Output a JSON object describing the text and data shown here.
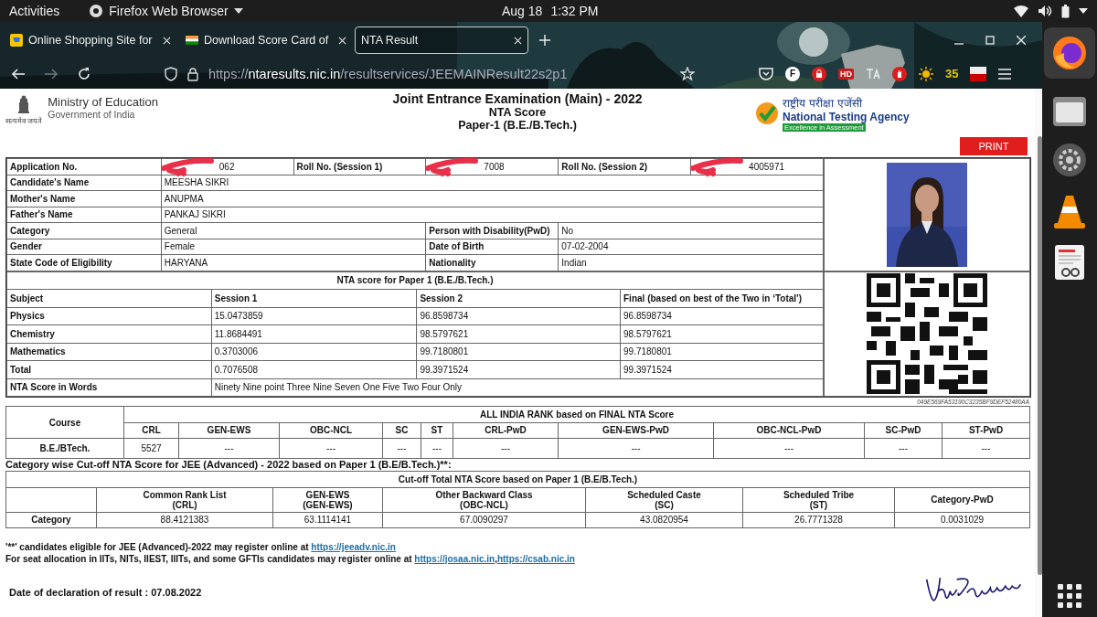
{
  "top_bar": {
    "activities": "Activities",
    "app_menu": "Firefox Web Browser",
    "date": "Aug 18",
    "time": "1:32 PM"
  },
  "tabs": [
    {
      "title": "Online Shopping Site for",
      "kind": "shop",
      "selected": false
    },
    {
      "title": "Download Score Card of",
      "kind": "flag",
      "selected": false
    },
    {
      "title": "NTA Result",
      "kind": "plain",
      "selected": true
    }
  ],
  "nav": {
    "forward_disabled": true,
    "url_scheme": "https://",
    "url_host": "ntaresults.nic.in",
    "url_path": "/resultservices/JEEMAINResult22s2p1",
    "badge": "35",
    "letter_icon": "F",
    "hd_icon": "HD"
  },
  "header": {
    "ministry": "Ministry of Education",
    "government": "Government of India",
    "motto": "सत्यमेव जयते",
    "title": "Joint Entrance Examination (Main) - 2022",
    "subtitle": "NTA Score",
    "paper": "Paper-1 (B.E./B.Tech.)",
    "agency_hindi": "राष्ट्रीय परीक्षा एजेंसी",
    "agency": "National Testing Agency",
    "agency_tag": "Excellence in Assessment",
    "print": "PRINT"
  },
  "candidate": [
    {
      "kind": "triple",
      "cells": [
        {
          "label": "Application No.",
          "value": "062"
        },
        {
          "label": "Roll No. (Session 1)",
          "value": "7008"
        },
        {
          "label": "Roll No. (Session 2)",
          "value": "4005971"
        }
      ]
    },
    {
      "kind": "full",
      "cells": [
        {
          "label": "Candidate's Name",
          "value": "MEESHA SIKRI"
        }
      ]
    },
    {
      "kind": "full",
      "cells": [
        {
          "label": "Mother's Name",
          "value": "ANUPMA"
        }
      ]
    },
    {
      "kind": "full",
      "cells": [
        {
          "label": "Father's Name",
          "value": "PANKAJ SIKRI"
        }
      ]
    },
    {
      "kind": "pair",
      "cells": [
        {
          "label": "Category",
          "value": "General"
        },
        {
          "label": "Person with Disability(PwD)",
          "value": "No"
        }
      ]
    },
    {
      "kind": "pair",
      "cells": [
        {
          "label": "Gender",
          "value": "Female"
        },
        {
          "label": "Date of Birth",
          "value": "07-02-2004"
        }
      ]
    },
    {
      "kind": "pair",
      "cells": [
        {
          "label": "State Code of Eligibility",
          "value": "HARYANA"
        },
        {
          "label": "Nationality",
          "value": "Indian"
        }
      ]
    }
  ],
  "score": {
    "title": "NTA score for Paper 1 (B.E./B.Tech.)",
    "columns": [
      "Subject",
      "Session 1",
      "Session 2",
      "Final (based on best of the Two in ‘Total’)"
    ],
    "rows": [
      [
        "Physics",
        "15.0473859",
        "96.8598734",
        "96.8598734"
      ],
      [
        "Chemistry",
        "11.8684491",
        "98.5797621",
        "98.5797621"
      ],
      [
        "Mathematics",
        "0.3703006",
        "99.7180801",
        "99.7180801"
      ],
      [
        "Total",
        "0.7076508",
        "99.3971524",
        "99.3971524"
      ]
    ],
    "words_label": "NTA Score in Words",
    "words": "Ninety Nine point Three Nine Seven One Five Two Four Only"
  },
  "hash": "049E569FA53190C3235BF9DEF52480AA",
  "rank": {
    "course_header": "Course",
    "title": "ALL INDIA RANK based on FINAL NTA Score",
    "columns": [
      "CRL",
      "GEN-EWS",
      "OBC-NCL",
      "SC",
      "ST",
      "CRL-PwD",
      "GEN-EWS-PwD",
      "OBC-NCL-PwD",
      "SC-PwD",
      "ST-PwD"
    ],
    "course": "B.E./BTech.",
    "values": [
      "5527",
      "---",
      "---",
      "---",
      "---",
      "---",
      "---",
      "---",
      "---",
      "---"
    ]
  },
  "cutoff": {
    "heading": "Category wise Cut-off NTA Score for JEE (Advanced) - 2022 based on Paper 1 (B.E/B.Tech.)**:",
    "title": "Cut-off Total NTA Score based on Paper 1 (B.E/B.Tech.)",
    "columns": [
      {
        "name": "Common Rank List",
        "code": "(CRL)"
      },
      {
        "name": "GEN-EWS",
        "code": "(GEN-EWS)"
      },
      {
        "name": "Other Backward Class",
        "code": "(OBC-NCL)"
      },
      {
        "name": "Scheduled Caste",
        "code": "(SC)"
      },
      {
        "name": "Scheduled Tribe",
        "code": "(ST)"
      },
      {
        "name": "Category-PwD"
      }
    ],
    "row_label": "Category",
    "values": [
      "88.4121383",
      "63.1114141",
      "67.0090297",
      "43.0820954",
      "26.7771328",
      "0.0031029"
    ]
  },
  "notes": [
    {
      "text": "'**' candidates eligible for JEE (Advanced)-2022 may register online at",
      "links": [
        "https://jeeadv.nic.in"
      ]
    },
    {
      "text": "For seat allocation in IITs, NITs, IIEST, IIITs, and some GFTIs candidates may register online at",
      "links": [
        "https://josaa.nic.in",
        "https://csab.nic.in"
      ],
      "separator": ","
    }
  ],
  "declaration": "Date of declaration of result : 07.08.2022"
}
